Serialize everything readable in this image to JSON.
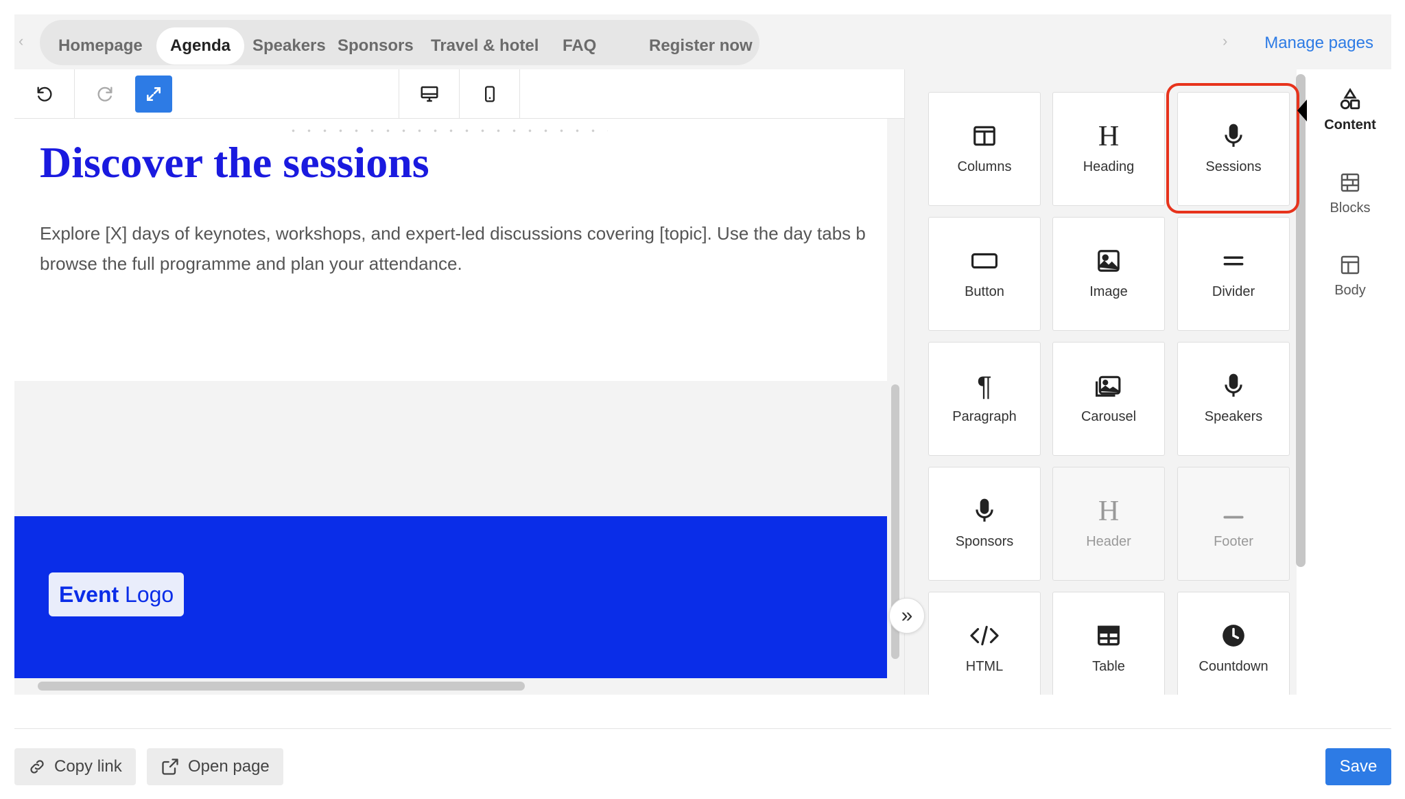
{
  "nav": {
    "tabs": [
      {
        "label": "Homepage"
      },
      {
        "label": "Agenda"
      },
      {
        "label": "Speakers"
      },
      {
        "label": "Sponsors"
      },
      {
        "label": "Travel & hotel"
      },
      {
        "label": "FAQ"
      },
      {
        "label": "Register now"
      }
    ],
    "active_tab": "Agenda",
    "manage_pages": "Manage pages"
  },
  "toolbar": {
    "icons": [
      "undo-icon",
      "redo-icon",
      "expand-icon",
      "desktop-icon",
      "mobile-icon"
    ]
  },
  "canvas": {
    "title": "Discover the sessions",
    "intro": "Explore [X] days of keynotes, workshops, and expert-led discussions covering [topic]. Use the day tabs b browse the full programme and plan your attendance.",
    "logo_bold": "Event",
    "logo_rest": " Logo"
  },
  "panel": {
    "tiles": [
      {
        "label": "Columns",
        "icon": "columns-icon"
      },
      {
        "label": "Heading",
        "icon": "heading-icon"
      },
      {
        "label": "Sessions",
        "icon": "microphone-icon"
      },
      {
        "label": "Button",
        "icon": "button-icon"
      },
      {
        "label": "Image",
        "icon": "image-icon"
      },
      {
        "label": "Divider",
        "icon": "divider-icon"
      },
      {
        "label": "Paragraph",
        "icon": "paragraph-icon"
      },
      {
        "label": "Carousel",
        "icon": "carousel-icon"
      },
      {
        "label": "Speakers",
        "icon": "microphone-icon"
      },
      {
        "label": "Sponsors",
        "icon": "microphone-icon"
      },
      {
        "label": "Header",
        "icon": "heading-icon"
      },
      {
        "label": "Footer",
        "icon": "footer-icon"
      },
      {
        "label": "HTML",
        "icon": "code-icon"
      },
      {
        "label": "Table",
        "icon": "table-icon"
      },
      {
        "label": "Countdown",
        "icon": "clock-icon"
      }
    ],
    "highlighted_tile": "Sessions"
  },
  "side_tabs": [
    {
      "label": "Content",
      "icon": "shapes-icon"
    },
    {
      "label": "Blocks",
      "icon": "blocks-icon"
    },
    {
      "label": "Body",
      "icon": "layout-icon"
    }
  ],
  "footer": {
    "copy_link": "Copy link",
    "open_page": "Open page",
    "save": "Save"
  },
  "colors": {
    "accent": "#2d7be5",
    "title": "#1a1adf",
    "brand_band": "#0a2de8",
    "highlight": "#e7331c"
  }
}
